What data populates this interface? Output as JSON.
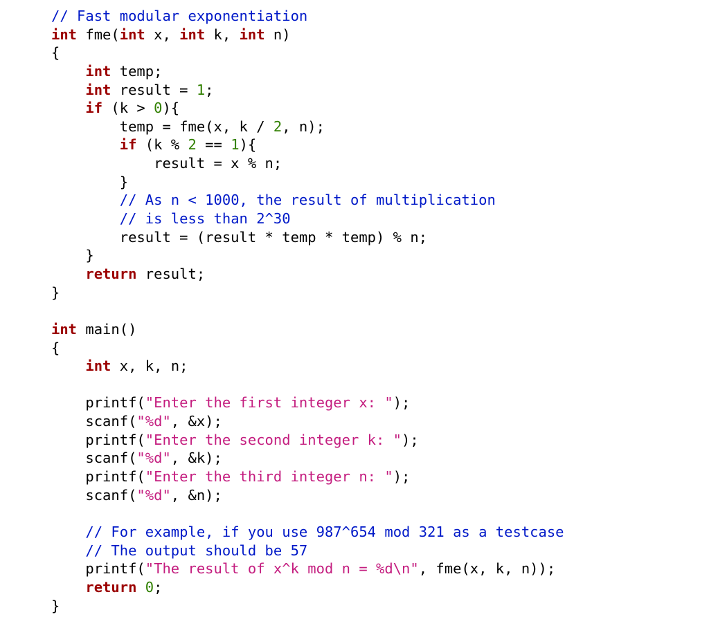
{
  "code": {
    "tokens": [
      [
        {
          "c": "cm",
          "t": "// Fast modular exponentiation"
        }
      ],
      [
        {
          "c": "kw",
          "t": "int"
        },
        {
          "c": "id",
          "t": " fme("
        },
        {
          "c": "kw",
          "t": "int"
        },
        {
          "c": "id",
          "t": " x, "
        },
        {
          "c": "kw",
          "t": "int"
        },
        {
          "c": "id",
          "t": " k, "
        },
        {
          "c": "kw",
          "t": "int"
        },
        {
          "c": "id",
          "t": " n)"
        }
      ],
      [
        {
          "c": "id",
          "t": "{"
        }
      ],
      [
        {
          "c": "id",
          "t": "    "
        },
        {
          "c": "kw",
          "t": "int"
        },
        {
          "c": "id",
          "t": " temp;"
        }
      ],
      [
        {
          "c": "id",
          "t": "    "
        },
        {
          "c": "kw",
          "t": "int"
        },
        {
          "c": "id",
          "t": " result = "
        },
        {
          "c": "num",
          "t": "1"
        },
        {
          "c": "id",
          "t": ";"
        }
      ],
      [
        {
          "c": "id",
          "t": "    "
        },
        {
          "c": "kw",
          "t": "if"
        },
        {
          "c": "id",
          "t": " (k > "
        },
        {
          "c": "num",
          "t": "0"
        },
        {
          "c": "id",
          "t": "){"
        }
      ],
      [
        {
          "c": "id",
          "t": "        temp = fme(x, k / "
        },
        {
          "c": "num",
          "t": "2"
        },
        {
          "c": "id",
          "t": ", n);"
        }
      ],
      [
        {
          "c": "id",
          "t": "        "
        },
        {
          "c": "kw",
          "t": "if"
        },
        {
          "c": "id",
          "t": " (k % "
        },
        {
          "c": "num",
          "t": "2"
        },
        {
          "c": "id",
          "t": " == "
        },
        {
          "c": "num",
          "t": "1"
        },
        {
          "c": "id",
          "t": "){"
        }
      ],
      [
        {
          "c": "id",
          "t": "            result = x % n;"
        }
      ],
      [
        {
          "c": "id",
          "t": "        }"
        }
      ],
      [
        {
          "c": "id",
          "t": "        "
        },
        {
          "c": "cm",
          "t": "// As n < 1000, the result of multiplication"
        }
      ],
      [
        {
          "c": "id",
          "t": "        "
        },
        {
          "c": "cm",
          "t": "// is less than 2^30"
        }
      ],
      [
        {
          "c": "id",
          "t": "        result = (result * temp * temp) % n;"
        }
      ],
      [
        {
          "c": "id",
          "t": "    }"
        }
      ],
      [
        {
          "c": "id",
          "t": "    "
        },
        {
          "c": "kw",
          "t": "return"
        },
        {
          "c": "id",
          "t": " result;"
        }
      ],
      [
        {
          "c": "id",
          "t": "}"
        }
      ],
      [],
      [
        {
          "c": "kw",
          "t": "int"
        },
        {
          "c": "id",
          "t": " main()"
        }
      ],
      [
        {
          "c": "id",
          "t": "{"
        }
      ],
      [
        {
          "c": "id",
          "t": "    "
        },
        {
          "c": "kw",
          "t": "int"
        },
        {
          "c": "id",
          "t": " x, k, n;"
        }
      ],
      [],
      [
        {
          "c": "id",
          "t": "    printf("
        },
        {
          "c": "str",
          "t": "\"Enter the first integer x: \""
        },
        {
          "c": "id",
          "t": ");"
        }
      ],
      [
        {
          "c": "id",
          "t": "    scanf("
        },
        {
          "c": "str",
          "t": "\"%d\""
        },
        {
          "c": "id",
          "t": ", &x);"
        }
      ],
      [
        {
          "c": "id",
          "t": "    printf("
        },
        {
          "c": "str",
          "t": "\"Enter the second integer k: \""
        },
        {
          "c": "id",
          "t": ");"
        }
      ],
      [
        {
          "c": "id",
          "t": "    scanf("
        },
        {
          "c": "str",
          "t": "\"%d\""
        },
        {
          "c": "id",
          "t": ", &k);"
        }
      ],
      [
        {
          "c": "id",
          "t": "    printf("
        },
        {
          "c": "str",
          "t": "\"Enter the third integer n: \""
        },
        {
          "c": "id",
          "t": ");"
        }
      ],
      [
        {
          "c": "id",
          "t": "    scanf("
        },
        {
          "c": "str",
          "t": "\"%d\""
        },
        {
          "c": "id",
          "t": ", &n);"
        }
      ],
      [],
      [
        {
          "c": "id",
          "t": "    "
        },
        {
          "c": "cm",
          "t": "// For example, if you use 987^654 mod 321 as a testcase"
        }
      ],
      [
        {
          "c": "id",
          "t": "    "
        },
        {
          "c": "cm",
          "t": "// The output should be 57"
        }
      ],
      [
        {
          "c": "id",
          "t": "    printf("
        },
        {
          "c": "str",
          "t": "\"The result of x^k mod n = %d\\n\""
        },
        {
          "c": "id",
          "t": ", fme(x, k, n));"
        }
      ],
      [
        {
          "c": "id",
          "t": "    "
        },
        {
          "c": "kw",
          "t": "return"
        },
        {
          "c": "id",
          "t": " "
        },
        {
          "c": "num",
          "t": "0"
        },
        {
          "c": "id",
          "t": ";"
        }
      ],
      [
        {
          "c": "id",
          "t": "}"
        }
      ]
    ]
  }
}
